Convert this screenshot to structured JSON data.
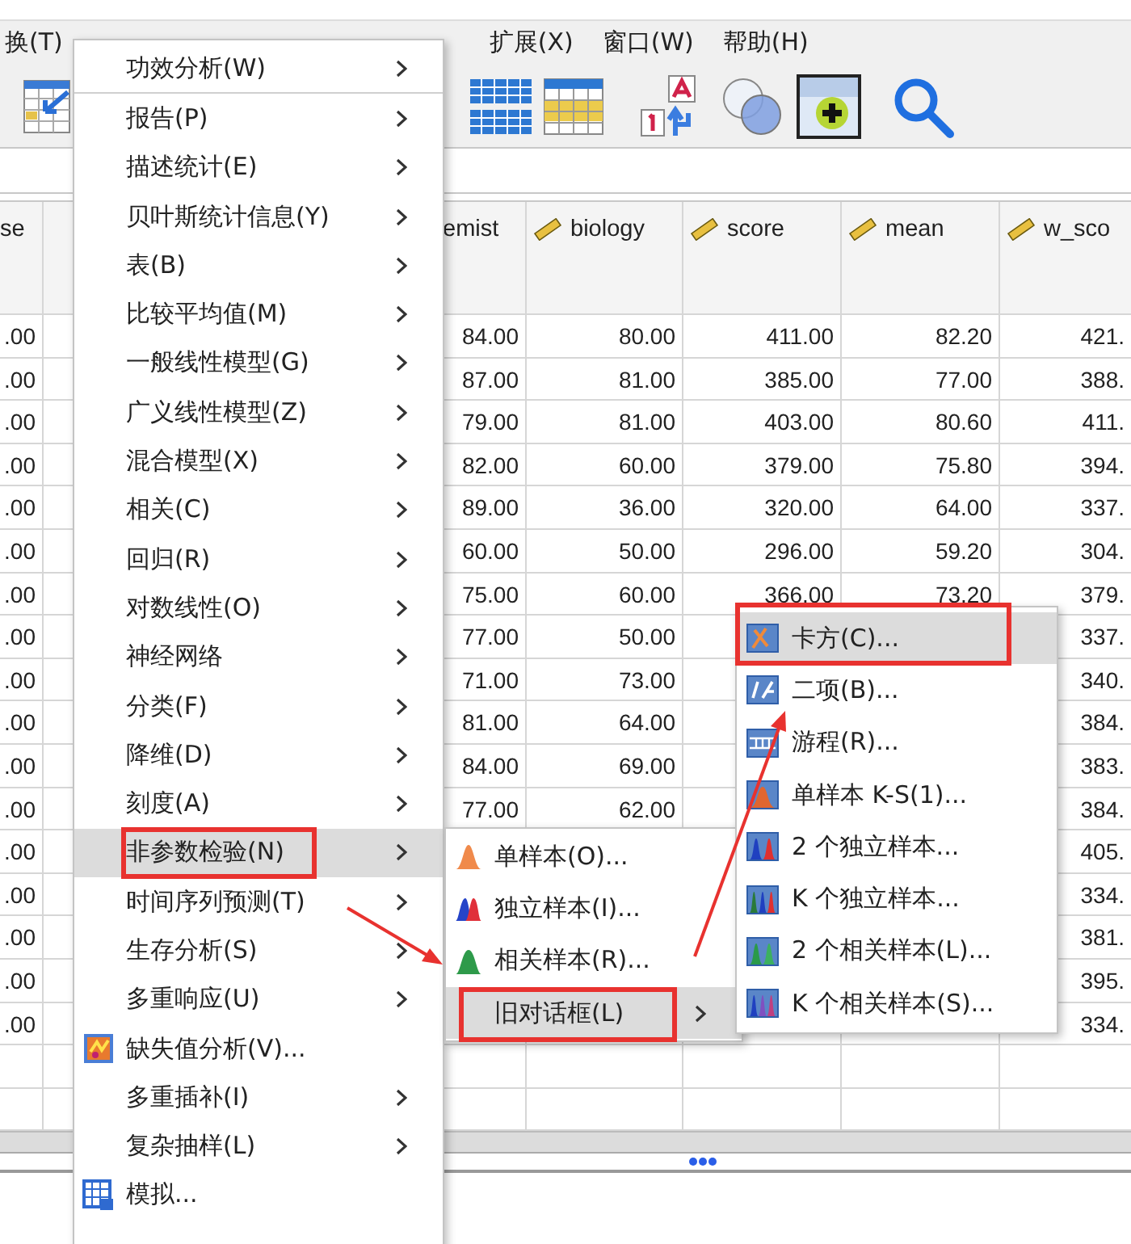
{
  "menubar": [
    {
      "label": "换(T)"
    },
    {
      "label": "扩展(X)"
    },
    {
      "label": "窗口(W)"
    },
    {
      "label": "帮助(H)"
    }
  ],
  "grid": {
    "columns": [
      {
        "header": "se",
        "scale": false
      },
      {
        "header": "emist",
        "scale": false
      },
      {
        "header": "biology",
        "scale": true
      },
      {
        "header": "score",
        "scale": true
      },
      {
        "header": "mean",
        "scale": true
      },
      {
        "header": "w_sco",
        "scale": true
      }
    ],
    "rows": [
      [
        ".00",
        "84.00",
        "80.00",
        "411.00",
        "82.20",
        "421."
      ],
      [
        ".00",
        "87.00",
        "81.00",
        "385.00",
        "77.00",
        "388."
      ],
      [
        ".00",
        "79.00",
        "81.00",
        "403.00",
        "80.60",
        "411."
      ],
      [
        ".00",
        "82.00",
        "60.00",
        "379.00",
        "75.80",
        "394."
      ],
      [
        ".00",
        "89.00",
        "36.00",
        "320.00",
        "64.00",
        "337."
      ],
      [
        ".00",
        "60.00",
        "50.00",
        "296.00",
        "59.20",
        "304."
      ],
      [
        ".00",
        "75.00",
        "60.00",
        "366.00",
        "73.20",
        "379."
      ],
      [
        ".00",
        "77.00",
        "50.00",
        null,
        null,
        "337."
      ],
      [
        ".00",
        "71.00",
        "73.00",
        null,
        null,
        "340."
      ],
      [
        ".00",
        "81.00",
        "64.00",
        null,
        null,
        "384."
      ],
      [
        ".00",
        "84.00",
        "69.00",
        null,
        null,
        "383."
      ],
      [
        ".00",
        "77.00",
        "62.00",
        null,
        null,
        "384."
      ],
      [
        ".00",
        null,
        null,
        null,
        null,
        "405."
      ],
      [
        ".00",
        null,
        null,
        null,
        null,
        "334."
      ],
      [
        ".00",
        null,
        null,
        null,
        null,
        "381."
      ],
      [
        ".00",
        null,
        null,
        null,
        null,
        "395."
      ],
      [
        ".00",
        null,
        null,
        null,
        null,
        "334."
      ]
    ]
  },
  "analyze_menu": {
    "groups": [
      {
        "items": [
          {
            "label": "功效分析(W)",
            "submenu": true,
            "icon": false,
            "selected": false,
            "annotated": false
          }
        ]
      },
      {
        "items": [
          {
            "label": "报告(P)",
            "submenu": true,
            "icon": false,
            "selected": false,
            "annotated": false
          },
          {
            "label": "描述统计(E)",
            "submenu": true,
            "icon": false,
            "selected": false,
            "annotated": false
          },
          {
            "label": "贝叶斯统计信息(Y)",
            "submenu": true,
            "icon": false,
            "selected": false,
            "annotated": false
          },
          {
            "label": "表(B)",
            "submenu": true,
            "icon": false,
            "selected": false,
            "annotated": false
          },
          {
            "label": "比较平均值(M)",
            "submenu": true,
            "icon": false,
            "selected": false,
            "annotated": false
          },
          {
            "label": "一般线性模型(G)",
            "submenu": true,
            "icon": false,
            "selected": false,
            "annotated": false
          },
          {
            "label": "广义线性模型(Z)",
            "submenu": true,
            "icon": false,
            "selected": false,
            "annotated": false
          },
          {
            "label": "混合模型(X)",
            "submenu": true,
            "icon": false,
            "selected": false,
            "annotated": false
          },
          {
            "label": "相关(C)",
            "submenu": true,
            "icon": false,
            "selected": false,
            "annotated": false
          },
          {
            "label": "回归(R)",
            "submenu": true,
            "icon": false,
            "selected": false,
            "annotated": false
          },
          {
            "label": "对数线性(O)",
            "submenu": true,
            "icon": false,
            "selected": false,
            "annotated": false
          },
          {
            "label": "神经网络",
            "submenu": true,
            "icon": false,
            "selected": false,
            "annotated": false
          },
          {
            "label": "分类(F)",
            "submenu": true,
            "icon": false,
            "selected": false,
            "annotated": false
          },
          {
            "label": "降维(D)",
            "submenu": true,
            "icon": false,
            "selected": false,
            "annotated": false
          },
          {
            "label": "刻度(A)",
            "submenu": true,
            "icon": false,
            "selected": false,
            "annotated": false
          },
          {
            "label": "非参数检验(N)",
            "submenu": true,
            "icon": false,
            "selected": true,
            "annotated": true
          },
          {
            "label": "时间序列预测(T)",
            "submenu": true,
            "icon": false,
            "selected": false,
            "annotated": false
          },
          {
            "label": "生存分析(S)",
            "submenu": true,
            "icon": false,
            "selected": false,
            "annotated": false
          },
          {
            "label": "多重响应(U)",
            "submenu": true,
            "icon": false,
            "selected": false,
            "annotated": false
          },
          {
            "label": "缺失值分析(V)...",
            "submenu": false,
            "icon": true,
            "selected": false,
            "annotated": false
          },
          {
            "label": "多重插补(I)",
            "submenu": true,
            "icon": false,
            "selected": false,
            "annotated": false
          },
          {
            "label": "复杂抽样(L)",
            "submenu": true,
            "icon": false,
            "selected": false,
            "annotated": false
          },
          {
            "label": "模拟...",
            "submenu": false,
            "icon": true,
            "selected": false,
            "annotated": false
          }
        ]
      }
    ]
  },
  "nonparametric_menu": {
    "items": [
      {
        "label": "单样本(O)...",
        "submenu": false,
        "icon": true,
        "selected": false,
        "annotated": false
      },
      {
        "label": "独立样本(I)...",
        "submenu": false,
        "icon": true,
        "selected": false,
        "annotated": false
      },
      {
        "label": "相关样本(R)...",
        "submenu": false,
        "icon": true,
        "selected": false,
        "annotated": false
      },
      {
        "label": "旧对话框(L)",
        "submenu": true,
        "icon": false,
        "selected": true,
        "annotated": true
      }
    ]
  },
  "legacy_dialogs_menu": {
    "items": [
      {
        "label": "卡方(C)...",
        "selected": true,
        "annotated": true
      },
      {
        "label": "二项(B)...",
        "selected": false,
        "annotated": false
      },
      {
        "label": "游程(R)...",
        "selected": false,
        "annotated": false
      },
      {
        "label": "单样本 K-S(1)...",
        "selected": false,
        "annotated": false
      },
      {
        "label": "2 个独立样本...",
        "selected": false,
        "annotated": false
      },
      {
        "label": "K 个独立样本...",
        "selected": false,
        "annotated": false
      },
      {
        "label": "2 个相关样本(L)...",
        "selected": false,
        "annotated": false
      },
      {
        "label": "K 个相关样本(S)...",
        "selected": false,
        "annotated": false
      }
    ]
  }
}
